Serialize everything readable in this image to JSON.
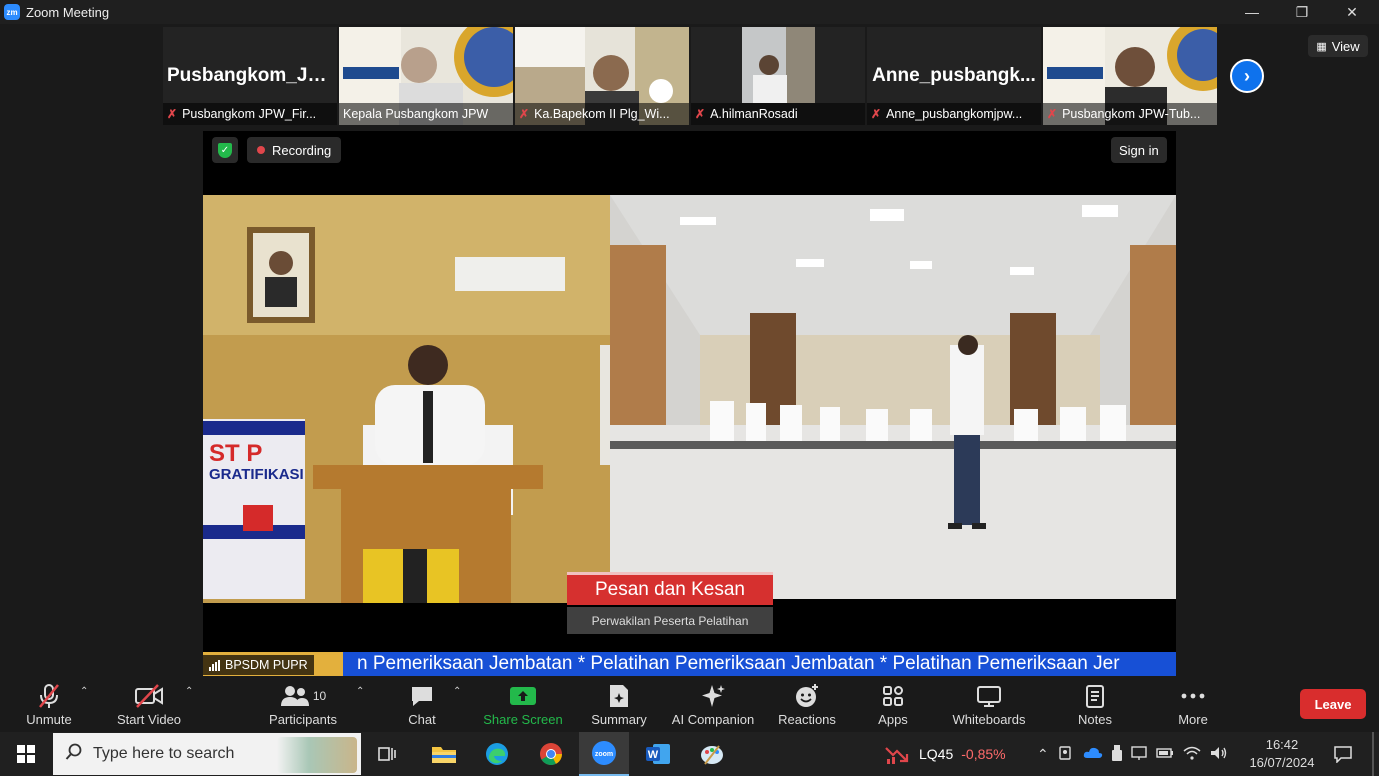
{
  "window": {
    "title": "Zoom Meeting",
    "app_icon": "zm"
  },
  "participants_strip": [
    {
      "display_name": "Pusbangkom_JP...",
      "label": "Pusbangkom JPW_Fir...",
      "has_video": false
    },
    {
      "display_name": "",
      "label": "Kepala Pusbangkom JPW",
      "has_video": true
    },
    {
      "display_name": "",
      "label": "Ka.Bapekom II Plg_Wi...",
      "has_video": true
    },
    {
      "display_name": "",
      "label": "A.hilmanRosadi",
      "has_video": true
    },
    {
      "display_name": "Anne_pusbangk...",
      "label": "Anne_pusbangkomjpw...",
      "has_video": false
    },
    {
      "display_name": "",
      "label": "Pusbangkom JPW-Tub...",
      "has_video": true
    }
  ],
  "view_button": "View",
  "share": {
    "recording": "Recording",
    "sign_in": "Sign in",
    "caption_title": "Pesan dan Kesan",
    "caption_sub": "Perwakilan Peserta Pelatihan",
    "ticker": "n Pemeriksaan Jembatan * Pelatihan Pemeriksaan Jembatan * Pelatihan Pemeriksaan Jer",
    "presenter": "BPSDM PUPR",
    "poster_line1": "ST P",
    "poster_line2": "GRATIFIKASI"
  },
  "toolbar": {
    "unmute": "Unmute",
    "start_video": "Start Video",
    "participants": "Participants",
    "participants_count": "10",
    "chat": "Chat",
    "share_screen": "Share Screen",
    "summary": "Summary",
    "ai_companion": "AI Companion",
    "reactions": "Reactions",
    "apps": "Apps",
    "whiteboards": "Whiteboards",
    "notes": "Notes",
    "more": "More",
    "leave": "Leave"
  },
  "taskbar": {
    "search_placeholder": "Type here to search",
    "stock_symbol": "LQ45",
    "stock_change": "-0,85%",
    "time": "16:42",
    "date": "16/07/2024"
  },
  "colors": {
    "accent": "#0e72ed",
    "share_green": "#23b94b",
    "leave_red": "#d92d2d",
    "ticker_blue": "#1750d6"
  }
}
